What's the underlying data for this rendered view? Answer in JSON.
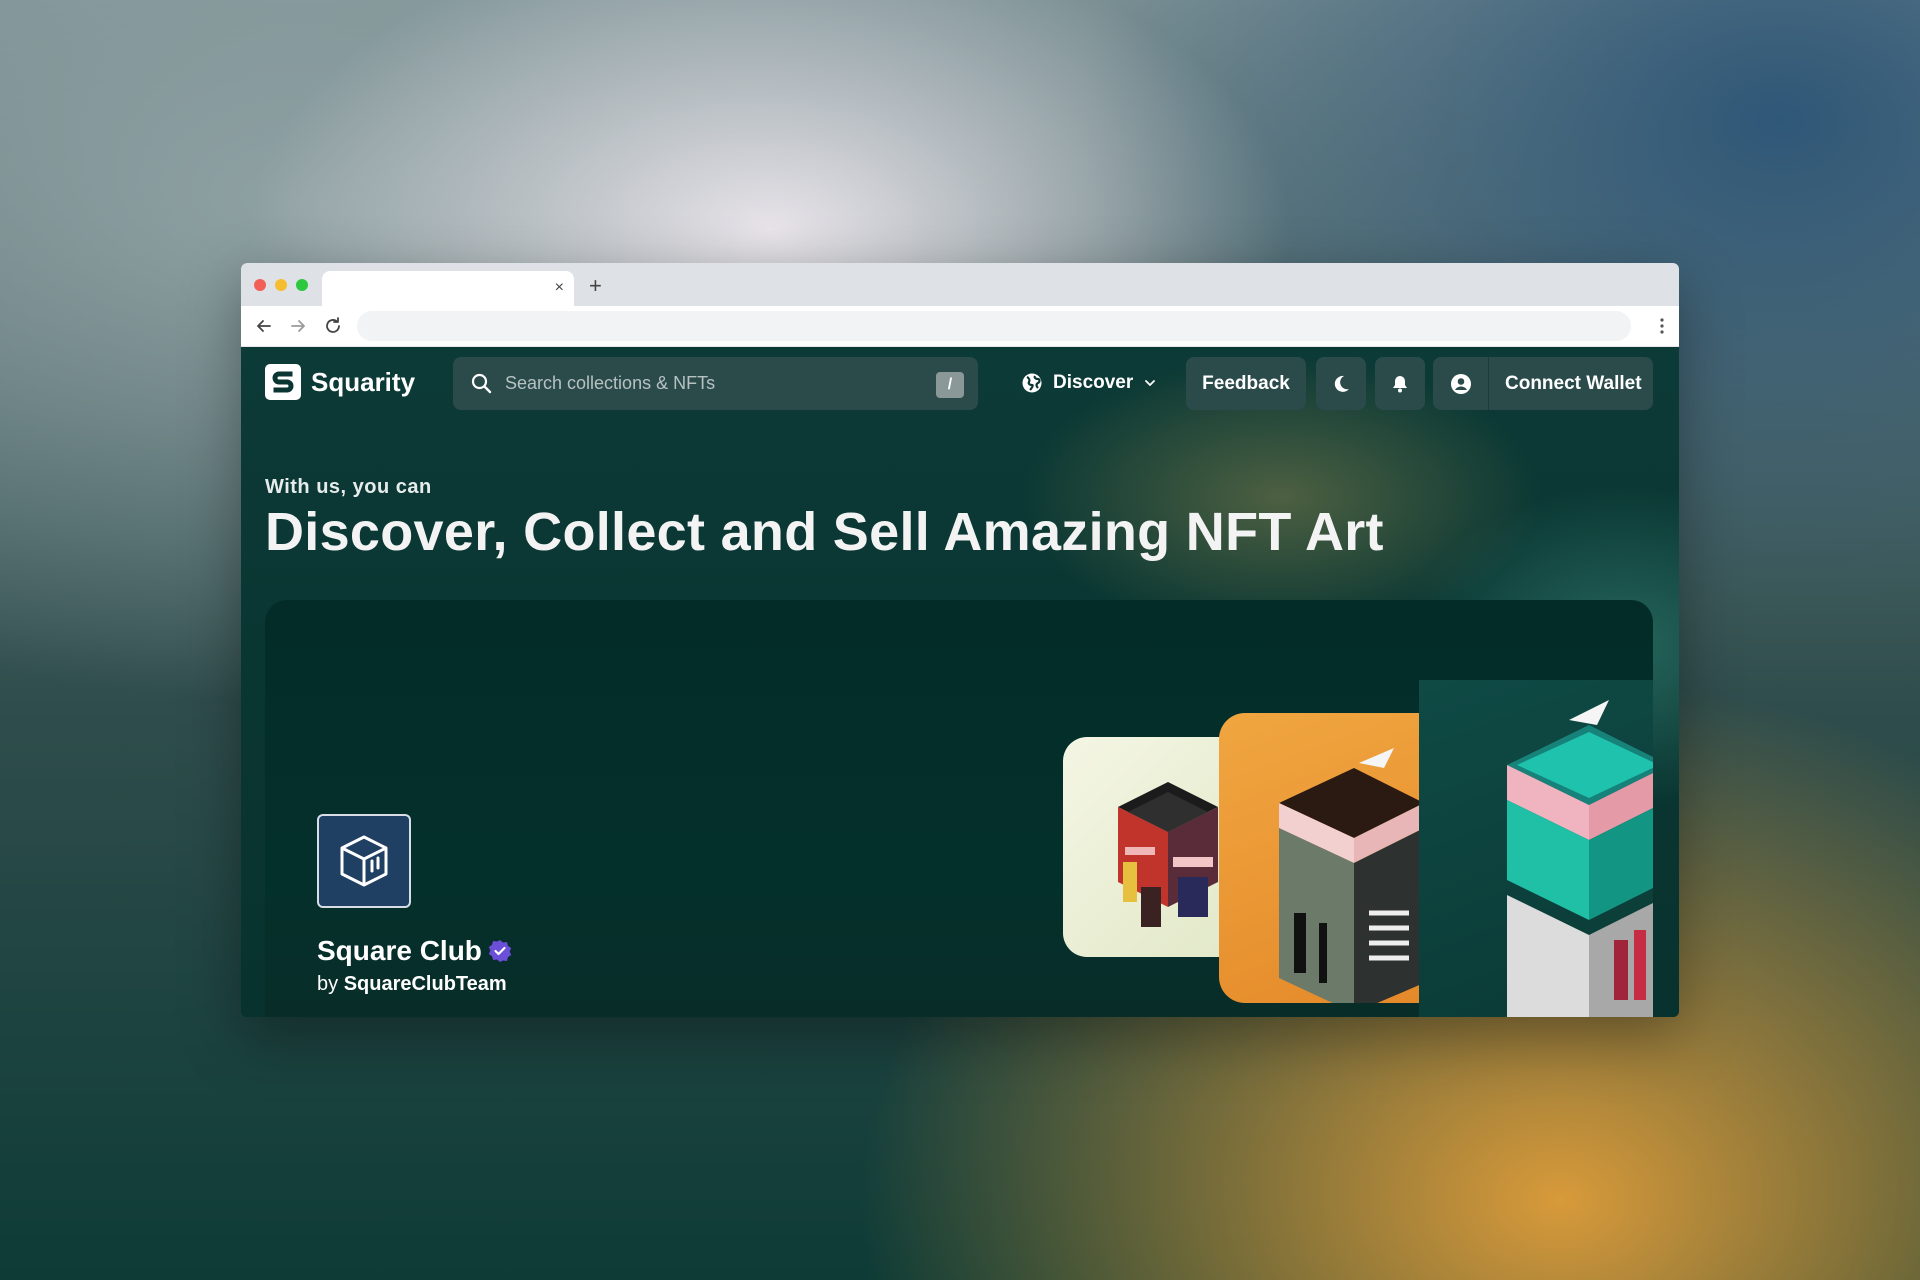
{
  "browser": {
    "tab_title": "",
    "tab_close": "×",
    "new_tab": "+",
    "url": ""
  },
  "site": {
    "brand": "Squarity",
    "search": {
      "placeholder": "Search collections & NFTs",
      "shortcut": "/"
    },
    "nav": {
      "discover_label": "Discover",
      "feedback_label": "Feedback",
      "connect_wallet_label": "Connect Wallet"
    },
    "hero": {
      "eyebrow": "With us, you can",
      "headline": "Discover, Collect and Sell Amazing NFT Art"
    },
    "featured": {
      "collection_name": "Square Club",
      "creator_prefix": "by",
      "creator_name": "SquareClubTeam",
      "verified": true
    }
  },
  "icons": {
    "search": "search-icon",
    "discover": "globe-icon",
    "dropdown": "chevron-down-icon",
    "theme": "moon-icon",
    "notifications": "bell-icon",
    "account": "user-circle-icon",
    "verified": "verified-badge-icon",
    "collection": "cube-icon"
  },
  "colors": {
    "background_dark": "#08322e",
    "pill": "#2b4b4b",
    "verified": "#6b4fd8",
    "art_orange": "#f0a640",
    "art_teal": "#1fb8a6"
  }
}
